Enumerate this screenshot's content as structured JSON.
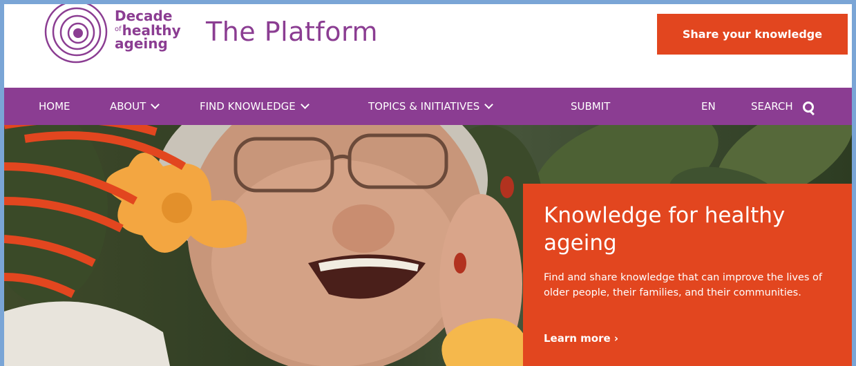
{
  "logo": {
    "line1": "Decade",
    "of": "of",
    "line2": "healthy",
    "line3": "ageing"
  },
  "header": {
    "title": "The Platform",
    "share_button": "Share your knowledge"
  },
  "nav": {
    "home": "HOME",
    "about": "ABOUT",
    "find": "FIND KNOWLEDGE",
    "topics": "TOPICS & INITIATIVES",
    "submit": "SUBMIT",
    "lang": "EN",
    "search": "SEARCH"
  },
  "hero": {
    "title": "Knowledge for healthy ageing",
    "text": "Find and share knowledge that can improve the lives of older people, their families, and their communities.",
    "link": "Learn more ›"
  },
  "colors": {
    "purple": "#8b3d92",
    "orange": "#e2461f",
    "page_border": "#7aa5d6"
  }
}
